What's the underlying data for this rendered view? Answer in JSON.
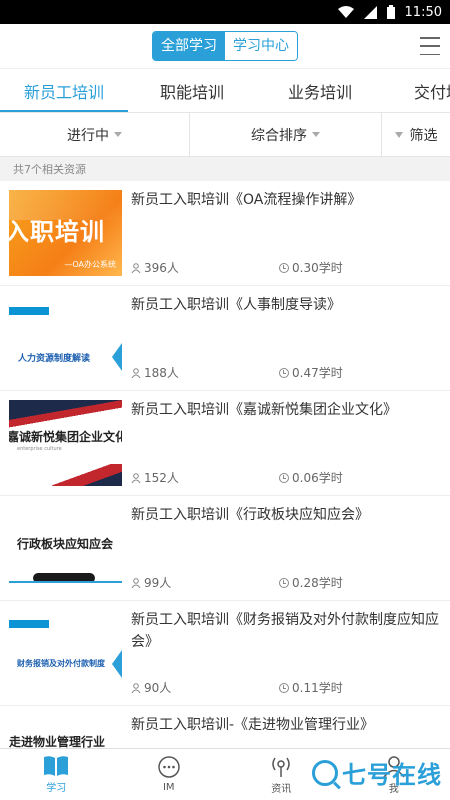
{
  "status": {
    "time": "11:50"
  },
  "header": {
    "seg_all": "全部学习",
    "seg_center": "学习中心"
  },
  "tabs": [
    {
      "label": "新员工培训",
      "active": true
    },
    {
      "label": "职能培训",
      "active": false
    },
    {
      "label": "业务培训",
      "active": false
    },
    {
      "label": "交付培",
      "active": false
    }
  ],
  "filters": {
    "status": "进行中",
    "sort": "综合排序",
    "filter": "筛选"
  },
  "count_text": "共7个相关资源",
  "items": [
    {
      "title": "新员工入职培训《OA流程操作讲解》",
      "learners": "396人",
      "hours": "0.30学时",
      "thumb_text": "入职培训",
      "thumb_sub": "—OA办公系统"
    },
    {
      "title": "新员工入职培训《人事制度导读》",
      "learners": "188人",
      "hours": "0.47学时",
      "thumb_text": "人力资源制度解读"
    },
    {
      "title": "新员工入职培训《嘉诚新悦集团企业文化》",
      "learners": "152人",
      "hours": "0.06学时",
      "thumb_text": "嘉诚新悦集团企业文化",
      "thumb_sub": "enterprise culture"
    },
    {
      "title": "新员工入职培训《行政板块应知应会》",
      "learners": "99人",
      "hours": "0.28学时",
      "thumb_text": "行政板块应知应会"
    },
    {
      "title": "新员工入职培训《财务报销及对外付款制度应知应会》",
      "learners": "90人",
      "hours": "0.11学时",
      "thumb_text": "财务报销及对外付款制度"
    },
    {
      "title": "新员工入职培训-《走进物业管理行业》",
      "learners": "",
      "hours": "",
      "thumb_text": "走进物业管理行业"
    }
  ],
  "bottom_nav": [
    {
      "label": "学习",
      "icon": "book-icon",
      "active": true
    },
    {
      "label": "IM",
      "icon": "chat-icon",
      "active": false
    },
    {
      "label": "资讯",
      "icon": "broadcast-icon",
      "active": false
    },
    {
      "label": "我",
      "icon": "user-icon",
      "active": false
    }
  ],
  "watermark": "七号在线",
  "colors": {
    "accent": "#2a9fd8"
  }
}
